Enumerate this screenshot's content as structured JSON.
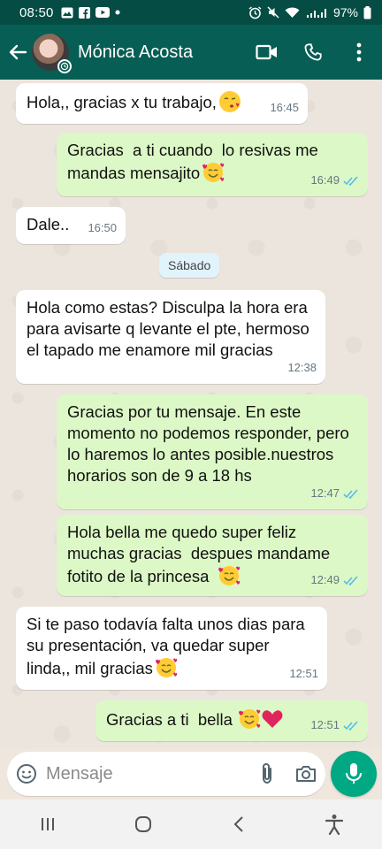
{
  "status_bar": {
    "time": "08:50",
    "battery": "97%"
  },
  "header": {
    "contact_name": "Mónica Acosta"
  },
  "chat": {
    "date_separator": "Sábado",
    "messages": [
      {
        "dir": "in",
        "text": "Hola,, gracias x tu trabajo,",
        "emoji": "kissing-heart",
        "time": "16:45"
      },
      {
        "dir": "out",
        "text": "Gracias  a ti cuando  lo resivas me mandas mensajito",
        "emoji": "smiling-hearts",
        "time": "16:49",
        "read": true
      },
      {
        "dir": "in",
        "text": "Dale..",
        "time": "16:50"
      },
      {
        "dir": "in",
        "text": "Hola como estas? Disculpa la hora era para avisarte q levante el pte, hermoso el tapado me enamore mil gracias",
        "time": "12:38"
      },
      {
        "dir": "out",
        "text": "Gracias por tu mensaje. En este momento no podemos responder, pero lo haremos lo antes posible.nuestros horarios son de 9 a 18 hs",
        "time": "12:47",
        "read": true
      },
      {
        "dir": "out",
        "text": "Hola bella me quedo super feliz muchas gracias  despues mandame fotito de la princesa",
        "emoji": "smiling-hearts",
        "time": "12:49",
        "read": true
      },
      {
        "dir": "in",
        "text": "Si te paso todavía falta unos dias para su presentación, va quedar super linda,, mil gracias",
        "emoji": "smiling-hearts",
        "time": "12:51"
      },
      {
        "dir": "out",
        "text": "Gracias a ti  bella",
        "emoji": "smiling-hearts-red-heart",
        "time": "12:51",
        "read": true
      }
    ]
  },
  "input": {
    "placeholder": "Mensaje"
  },
  "colors": {
    "header": "#075e54",
    "status_bar": "#054d44",
    "out_bubble": "#dcf8c6",
    "in_bubble": "#ffffff",
    "accent": "#00a884",
    "read_ticks": "#53bdeb"
  }
}
